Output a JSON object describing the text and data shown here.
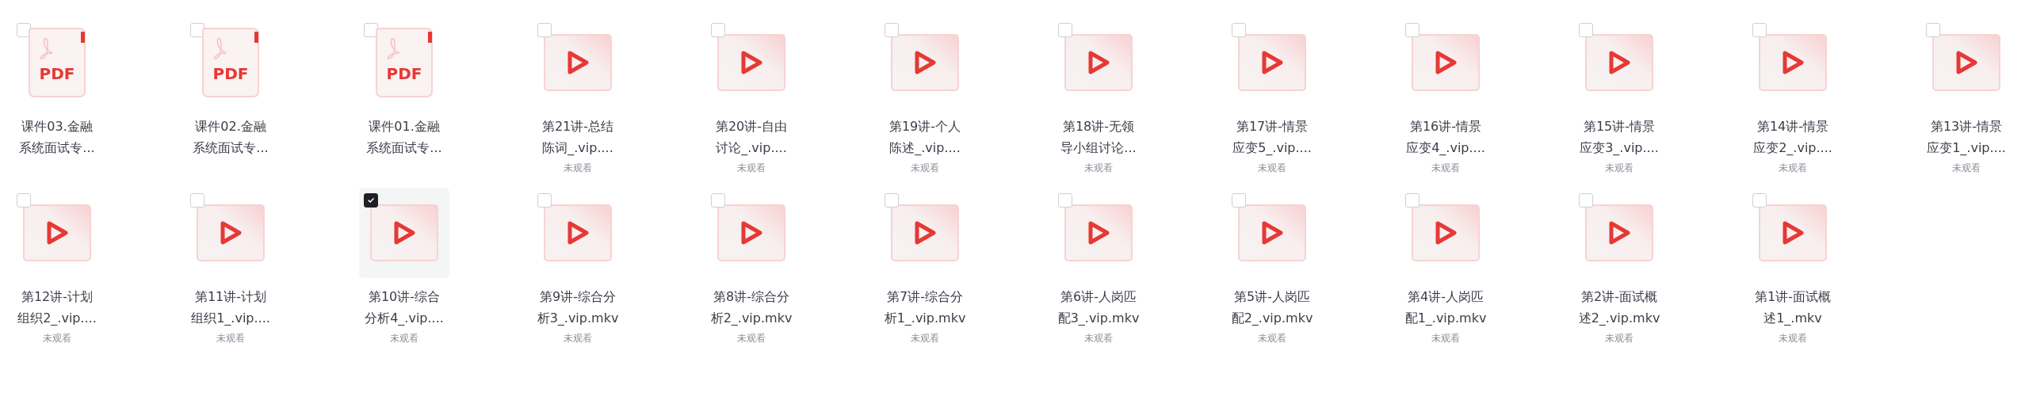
{
  "files": [
    {
      "kind": "pdf",
      "icon_text": "PDF",
      "name_lines": [
        "课件03.金融",
        "系统面试专..."
      ],
      "checked": false
    },
    {
      "kind": "pdf",
      "icon_text": "PDF",
      "name_lines": [
        "课件02.金融",
        "系统面试专..."
      ],
      "checked": false
    },
    {
      "kind": "pdf",
      "icon_text": "PDF",
      "name_lines": [
        "课件01.金融",
        "系统面试专..."
      ],
      "checked": false
    },
    {
      "kind": "video",
      "name_lines": [
        "第21讲-总结",
        "陈词_.vip...."
      ],
      "status": "未观看",
      "checked": false
    },
    {
      "kind": "video",
      "name_lines": [
        "第20讲-自由",
        "讨论_.vip...."
      ],
      "status": "未观看",
      "checked": false
    },
    {
      "kind": "video",
      "name_lines": [
        "第19讲-个人",
        "陈述_.vip...."
      ],
      "status": "未观看",
      "checked": false
    },
    {
      "kind": "video",
      "name_lines": [
        "第18讲-无领",
        "导小组讨论..."
      ],
      "status": "未观看",
      "checked": false
    },
    {
      "kind": "video",
      "name_lines": [
        "第17讲-情景",
        "应变5_.vip...."
      ],
      "status": "未观看",
      "checked": false
    },
    {
      "kind": "video",
      "name_lines": [
        "第16讲-情景",
        "应变4_.vip...."
      ],
      "status": "未观看",
      "checked": false
    },
    {
      "kind": "video",
      "name_lines": [
        "第15讲-情景",
        "应变3_.vip...."
      ],
      "status": "未观看",
      "checked": false
    },
    {
      "kind": "video",
      "name_lines": [
        "第14讲-情景",
        "应变2_.vip...."
      ],
      "status": "未观看",
      "checked": false
    },
    {
      "kind": "video",
      "name_lines": [
        "第13讲-情景",
        "应变1_.vip...."
      ],
      "status": "未观看",
      "checked": false
    },
    {
      "kind": "video",
      "name_lines": [
        "第12讲-计划",
        "组织2_.vip...."
      ],
      "status": "未观看",
      "checked": false
    },
    {
      "kind": "video",
      "name_lines": [
        "第11讲-计划",
        "组织1_.vip...."
      ],
      "status": "未观看",
      "checked": false
    },
    {
      "kind": "video",
      "name_lines": [
        "第10讲-综合",
        "分析4_.vip...."
      ],
      "status": "未观看",
      "checked": true
    },
    {
      "kind": "video",
      "name_lines": [
        "第9讲-综合分",
        "析3_.vip.mkv"
      ],
      "status": "未观看",
      "checked": false
    },
    {
      "kind": "video",
      "name_lines": [
        "第8讲-综合分",
        "析2_.vip.mkv"
      ],
      "status": "未观看",
      "checked": false
    },
    {
      "kind": "video",
      "name_lines": [
        "第7讲-综合分",
        "析1_.vip.mkv"
      ],
      "status": "未观看",
      "checked": false
    },
    {
      "kind": "video",
      "name_lines": [
        "第6讲-人岗匹",
        "配3_.vip.mkv"
      ],
      "status": "未观看",
      "checked": false
    },
    {
      "kind": "video",
      "name_lines": [
        "第5讲-人岗匹",
        "配2_.vip.mkv"
      ],
      "status": "未观看",
      "checked": false
    },
    {
      "kind": "video",
      "name_lines": [
        "第4讲-人岗匹",
        "配1_.vip.mkv"
      ],
      "status": "未观看",
      "checked": false
    },
    {
      "kind": "video",
      "name_lines": [
        "第2讲-面试概",
        "述2_.vip.mkv"
      ],
      "status": "未观看",
      "checked": false
    },
    {
      "kind": "video",
      "name_lines": [
        "第1讲-面试概",
        "述1_.mkv"
      ],
      "status": "未观看",
      "checked": false
    }
  ]
}
